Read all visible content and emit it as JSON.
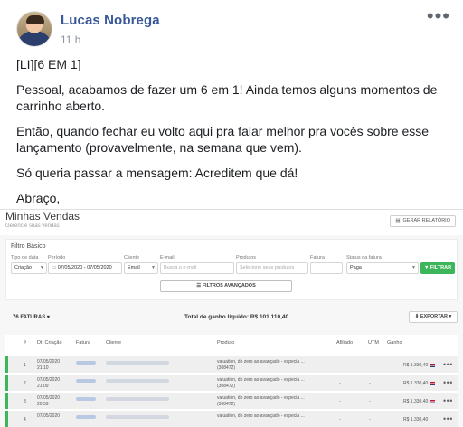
{
  "post": {
    "author": "Lucas Nobrega",
    "time": "11 h",
    "paragraphs": [
      "[LI][6 EM 1]",
      "Pessoal, acabamos de fazer um 6 em 1! Ainda temos alguns momentos de carrinho aberto.",
      "Então, quando fechar eu volto aqui pra falar melhor pra vocês sobre esse lançamento (provavelmente, na semana que vem).",
      "Só queria passar a mensagem: Acreditem que dá!",
      "Abraço,"
    ]
  },
  "screenshot": {
    "title": "Minhas Vendas",
    "subtitle": "Gerencie suas vendas",
    "report_button": "GERAR RELATÓRIO",
    "filter": {
      "title": "Filtro Básico",
      "labels": {
        "date_type": "Tipo de data",
        "period": "Período",
        "client": "Cliente",
        "email": "E-mail",
        "products": "Produtos",
        "invoice": "Fatura",
        "invoice_status": "Status da fatura"
      },
      "values": {
        "date_type": "Criação",
        "period": "07/05/2020  -  07/05/2020",
        "client": "Email",
        "email_placeholder": "Busca o e-mail",
        "products_placeholder": "Selecione seus produtos",
        "invoice": "",
        "invoice_status": "Paga"
      },
      "filter_button": "FILTRAR",
      "advanced_button": "FILTROS AVANÇADOS"
    },
    "summary": {
      "count": "76 FATURAS",
      "total_label": "Total de ganho líquido:",
      "total_value": "R$ 101.110,40",
      "export_button": "EXPORTAR"
    },
    "table": {
      "headers": [
        "#",
        "Dt. Criação",
        "Fatura",
        "Cliente",
        "Produto",
        "Afiliado",
        "UTM",
        "Ganho"
      ],
      "rows": [
        {
          "n": "1",
          "date": "07/05/2020",
          "time": "21:10",
          "product": "valuation, do zero ao avançado - especia ...",
          "code": "(308472)",
          "affiliate": "-",
          "utm": "-",
          "gain": "R$ 1.330,40"
        },
        {
          "n": "2",
          "date": "07/05/2020",
          "time": "21:09",
          "product": "valuation, do zero ao avançado - especia ...",
          "code": "(308472)",
          "affiliate": "-",
          "utm": "-",
          "gain": "R$ 1.330,40"
        },
        {
          "n": "3",
          "date": "07/05/2020",
          "time": "20:59",
          "product": "valuation, do zero ao avançado - especia ...",
          "code": "(308472)",
          "affiliate": "-",
          "utm": "-",
          "gain": "R$ 1.330,40"
        },
        {
          "n": "4",
          "date": "07/05/2020",
          "time": "",
          "product": "valuation, do zero ao avançado - especia ...",
          "code": "",
          "affiliate": "-",
          "utm": "-",
          "gain": "R$ 1.330,40"
        }
      ]
    }
  }
}
